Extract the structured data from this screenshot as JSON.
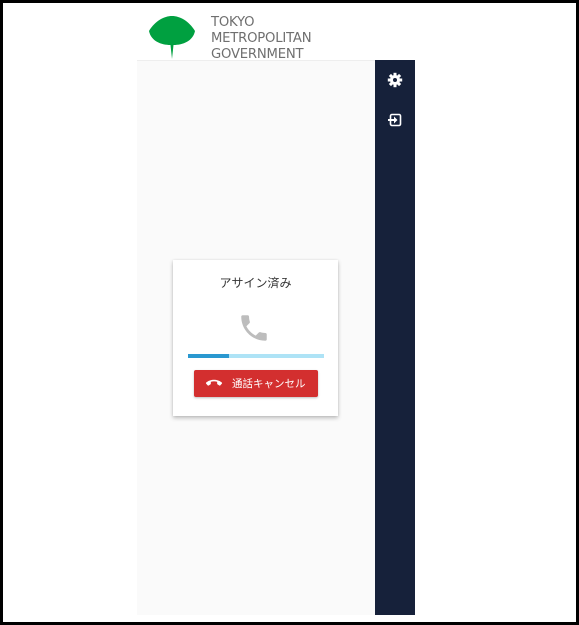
{
  "logo": {
    "lines": [
      "TOKYO",
      "METROPOLITAN",
      "GOVERNMENT"
    ],
    "icon": "ginkgo-leaf-logo",
    "color": "#00a040"
  },
  "sidebar": {
    "background": "#16213a",
    "items": [
      {
        "icon": "gear-icon"
      },
      {
        "icon": "logout-icon"
      }
    ]
  },
  "call_card": {
    "status": "アサイン済み",
    "icon": "phone-icon",
    "progress": 0.3,
    "progress_color": "#2a98d0",
    "cancel_button": {
      "label": "通話キャンセル",
      "icon": "hangup-phone-icon",
      "color": "#d32f2f"
    }
  }
}
